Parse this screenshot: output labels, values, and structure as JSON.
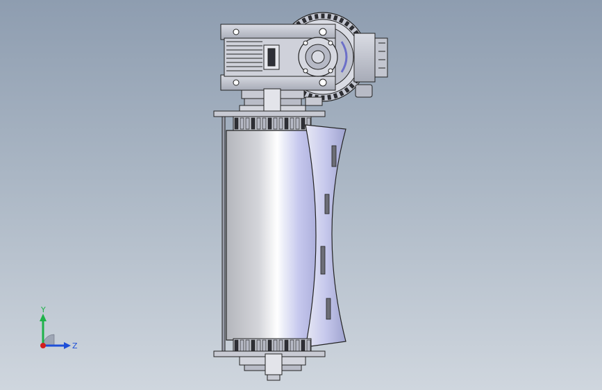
{
  "viewport": {
    "background_top": "#8e9db0",
    "background_bottom": "#cfd6de"
  },
  "model": {
    "name_icon": "roller-gearmotor-assembly",
    "colors": {
      "metal": "#c9ccd6",
      "metal_dark": "#9a9eab",
      "outline": "#2a2a30",
      "roller_highlight": "#f3f4fb",
      "roller_blue": "#b9bde8"
    }
  },
  "triad": {
    "y_label": "Y",
    "z_label": "Z",
    "y_color": "#1fb24a",
    "z_color": "#1e4fd8",
    "x_color": "#d21f1f"
  }
}
